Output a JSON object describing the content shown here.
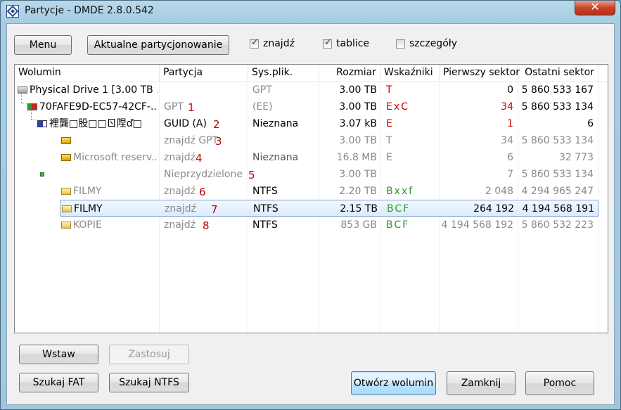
{
  "window": {
    "title": "Partycje - DMDE 2.8.0.542",
    "close_label": "✕"
  },
  "toolbar": {
    "menu_label": "Menu",
    "current_label": "Aktualne partycjonowanie",
    "checks": [
      {
        "label": "znajdź",
        "checked": true
      },
      {
        "label": "tablice",
        "checked": true
      },
      {
        "label": "szczegóły",
        "checked": false
      }
    ]
  },
  "table": {
    "columns": [
      "Wolumin",
      "Partycja",
      "Sys.plik.",
      "Rozmiar",
      "Wskaźniki",
      "Pierwszy sektor",
      "Ostatni sektor"
    ],
    "rows": [
      {
        "icon": "drive-icon",
        "wolumin": "Physical Drive 1 [3.00 TB ...",
        "partycja": "",
        "marker": "",
        "sys": "GPT",
        "rozmiar": "3.00 TB",
        "flags": "T",
        "first": "0",
        "last": "5 860 533 167"
      },
      {
        "icon": "partition-table-icon",
        "wolumin": "70FAFE9D-EC57-42CF-...",
        "partycja": "GPT",
        "marker": "1",
        "sys": "(EE)",
        "rozmiar": "3.00 TB",
        "flags": "ExC",
        "first": "34",
        "last": "5 860 533 134"
      },
      {
        "icon": "guid-partition-icon",
        "wolumin": "裡龔□股□□ㄖ陧ď□",
        "partycja": "GUID (A)",
        "marker": "2",
        "sys": "Nieznana",
        "rozmiar": "3.07 kB",
        "flags": "E",
        "first": "1",
        "last": "6"
      },
      {
        "icon": "found-gpt-icon",
        "wolumin": "",
        "partycja": "znajdź GPT",
        "marker": "3",
        "sys": "",
        "rozmiar": "3.00 TB",
        "flags": "T",
        "first": "34",
        "last": "5 860 533 134"
      },
      {
        "icon": "found-volume-icon",
        "wolumin": "Microsoft reserv...",
        "partycja": "znajdź",
        "marker": "4",
        "sys": "Nieznana",
        "rozmiar": "16.8 MB",
        "flags": "E",
        "first": "6",
        "last": "32 773"
      },
      {
        "icon": "unallocated-icon",
        "wolumin": "",
        "partycja": "Nieprzydzielone",
        "marker": "5",
        "sys": "",
        "rozmiar": "3.00 TB",
        "flags": "",
        "first": "7",
        "last": "5 860 533 134"
      },
      {
        "icon": "folder-icon",
        "wolumin": "FILMY",
        "partycja": "znajdź",
        "marker": "6",
        "sys": "NTFS",
        "rozmiar": "2.20 TB",
        "flags": "Bxxf",
        "first": "2 048",
        "last": "4 294 965 247"
      },
      {
        "icon": "folder-icon",
        "wolumin": "FILMY",
        "partycja": "znajdź",
        "marker": "7",
        "sys": "NTFS",
        "rozmiar": "2.15 TB",
        "flags": "BCF",
        "first": "264 192",
        "last": "4 194 568 191"
      },
      {
        "icon": "folder-icon",
        "wolumin": "KOPIE",
        "partycja": "znajdź",
        "marker": "8",
        "sys": "NTFS",
        "rozmiar": "853 GB",
        "flags": "BCF",
        "first": "4 194 568 192",
        "last": "5 860 532 223"
      }
    ]
  },
  "buttons": {
    "insert": "Wstaw",
    "apply": "Zastosuj",
    "search_fat": "Szukaj FAT",
    "search_ntfs": "Szukaj NTFS",
    "open_volume": "Otwórz wolumin",
    "close": "Zamknij",
    "help": "Pomoc"
  }
}
